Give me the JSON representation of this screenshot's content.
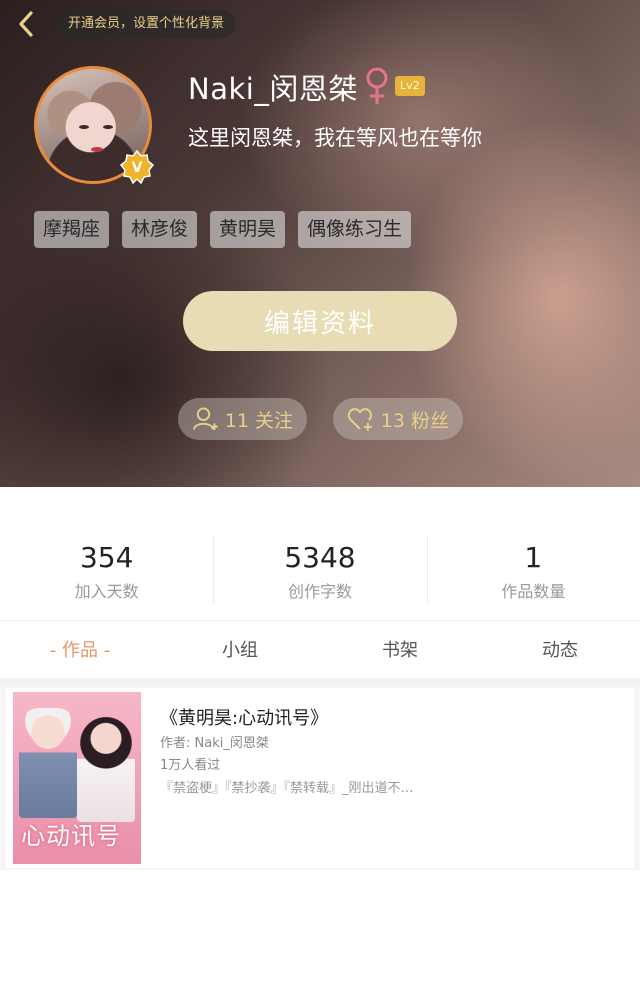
{
  "header": {
    "vip_banner": "开通会员，设置个性化背景"
  },
  "profile": {
    "username": "Naki_闵恩桀",
    "level_badge": "Lv2",
    "verified_badge": "V",
    "signature": "这里闵恩桀，我在等风也在等你",
    "tags": [
      "摩羯座",
      "林彦俊",
      "黄明昊",
      "偶像练习生"
    ],
    "edit_label": "编辑资料",
    "following_label": "11 关注",
    "fans_label": "13 粉丝"
  },
  "stats": [
    {
      "value": "354",
      "label": "加入天数"
    },
    {
      "value": "5348",
      "label": "创作字数"
    },
    {
      "value": "1",
      "label": "作品数量"
    }
  ],
  "tabs": [
    "- 作品 -",
    "小组",
    "书架",
    "动态"
  ],
  "active_tab": "- 作品 -",
  "works": [
    {
      "title": "《黄明昊:心动讯号》",
      "author": "作者: Naki_闵恩桀",
      "views": "1万人看过",
      "description": "『禁盗梗』『禁抄袭』『禁转载』_刚出道不…",
      "cover_text": "心动讯号"
    }
  ],
  "colors": {
    "accent_orange": "#e59766",
    "gold": "#e9cf8a",
    "edit_button": "#e8dcb4",
    "female_icon": "#e8728a"
  },
  "icons": {
    "back": "chevron-left-icon",
    "female": "female-symbol-icon",
    "follow": "add-user-icon",
    "fans": "heart-plus-icon"
  }
}
